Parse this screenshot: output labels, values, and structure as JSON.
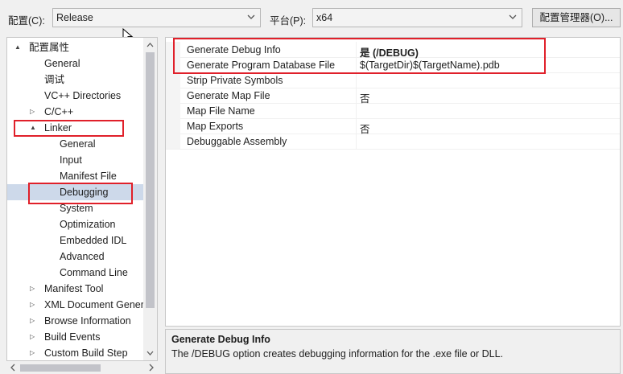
{
  "toolbar": {
    "config_label": "配置(C):",
    "config_value": "Release",
    "platform_label": "平台(P):",
    "platform_value": "x64",
    "config_manager_label": "配置管理器(O)..."
  },
  "tree": {
    "items": [
      {
        "label": "配置属性",
        "arrow": "▲"
      },
      {
        "label": "General",
        "arrow": ""
      },
      {
        "label": "调试",
        "arrow": ""
      },
      {
        "label": "VC++ Directories",
        "arrow": ""
      },
      {
        "label": "C/C++",
        "arrow": "▷"
      },
      {
        "label": "Linker",
        "arrow": "▲"
      },
      {
        "label": "General",
        "arrow": ""
      },
      {
        "label": "Input",
        "arrow": ""
      },
      {
        "label": "Manifest File",
        "arrow": ""
      },
      {
        "label": "Debugging",
        "arrow": ""
      },
      {
        "label": "System",
        "arrow": ""
      },
      {
        "label": "Optimization",
        "arrow": ""
      },
      {
        "label": "Embedded IDL",
        "arrow": ""
      },
      {
        "label": "Advanced",
        "arrow": ""
      },
      {
        "label": "Command Line",
        "arrow": ""
      },
      {
        "label": "Manifest Tool",
        "arrow": "▷"
      },
      {
        "label": "XML Document Generator",
        "arrow": "▷"
      },
      {
        "label": "Browse Information",
        "arrow": "▷"
      },
      {
        "label": "Build Events",
        "arrow": "▷"
      },
      {
        "label": "Custom Build Step",
        "arrow": "▷"
      }
    ],
    "selected_index": 9
  },
  "properties": [
    {
      "name": "Generate Debug Info",
      "value": "是 (/DEBUG)"
    },
    {
      "name": "Generate Program Database File",
      "value": "$(TargetDir)$(TargetName).pdb"
    },
    {
      "name": "Strip Private Symbols",
      "value": ""
    },
    {
      "name": "Generate Map File",
      "value": "否"
    },
    {
      "name": "Map File Name",
      "value": ""
    },
    {
      "name": "Map Exports",
      "value": "否"
    },
    {
      "name": "Debuggable Assembly",
      "value": ""
    }
  ],
  "description": {
    "title": "Generate Debug Info",
    "text": "The /DEBUG option creates debugging information for the .exe file or DLL."
  },
  "colors": {
    "highlight": "#e0202a",
    "selection": "#cdd9ea"
  },
  "icons": {
    "combo_dropdown": "chevron-down-icon",
    "tree_expanded": "triangle-expanded-icon",
    "tree_collapsed": "triangle-collapsed-icon",
    "cursor": "mouse-pointer-icon"
  }
}
